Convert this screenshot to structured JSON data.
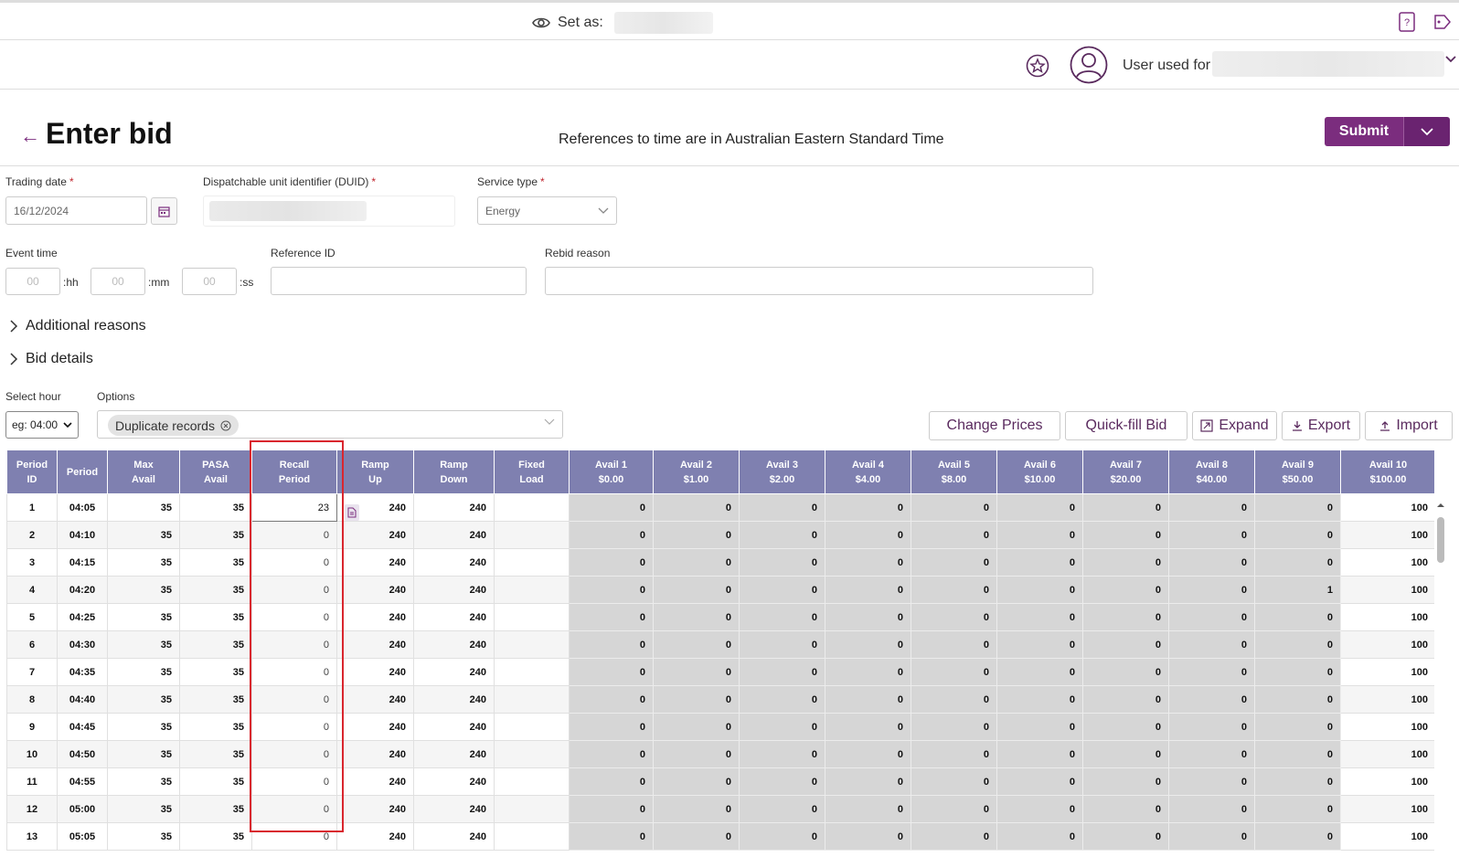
{
  "topbar": {
    "set_as_label": "Set as:"
  },
  "user": {
    "label": "User used for"
  },
  "header": {
    "title": "Enter bid",
    "timezone_note": "References to time are in Australian Eastern Standard Time",
    "submit_label": "Submit"
  },
  "form": {
    "trading_date_label": "Trading date",
    "trading_date_value": "16/12/2024",
    "duid_label": "Dispatchable unit identifier (DUID)",
    "service_type_label": "Service type",
    "service_type_value": "Energy",
    "event_time_label": "Event time",
    "hh_placeholder": "00",
    "mm_placeholder": "00",
    "ss_placeholder": "00",
    "hh_suffix": ":hh",
    "mm_suffix": ":mm",
    "ss_suffix": ":ss",
    "reference_id_label": "Reference ID",
    "rebid_reason_label": "Rebid reason",
    "required_mark": "*"
  },
  "sections": {
    "additional_reasons": "Additional reasons",
    "bid_details": "Bid details"
  },
  "controls": {
    "select_hour_label": "Select hour",
    "select_hour_value": "eg: 04:00",
    "options_label": "Options",
    "option_chip": "Duplicate records",
    "change_prices": "Change Prices",
    "quick_fill": "Quick-fill Bid",
    "expand": "Expand",
    "export": "Export",
    "import": "Import"
  },
  "grid": {
    "headers": [
      [
        "Period",
        "ID"
      ],
      [
        "Period",
        ""
      ],
      [
        "Max",
        "Avail"
      ],
      [
        "PASA",
        "Avail"
      ],
      [
        "Recall",
        "Period"
      ],
      [
        "Ramp",
        "Up"
      ],
      [
        "Ramp",
        "Down"
      ],
      [
        "Fixed",
        "Load"
      ],
      [
        "Avail 1",
        "$0.00"
      ],
      [
        "Avail 2",
        "$1.00"
      ],
      [
        "Avail 3",
        "$2.00"
      ],
      [
        "Avail 4",
        "$4.00"
      ],
      [
        "Avail 5",
        "$8.00"
      ],
      [
        "Avail 6",
        "$10.00"
      ],
      [
        "Avail 7",
        "$20.00"
      ],
      [
        "Avail 8",
        "$40.00"
      ],
      [
        "Avail 9",
        "$50.00"
      ],
      [
        "Avail 10",
        "$100.00"
      ]
    ],
    "rows": [
      [
        "1",
        "04:05",
        "35",
        "35",
        "23",
        "240",
        "240",
        "",
        "0",
        "0",
        "0",
        "0",
        "0",
        "0",
        "0",
        "0",
        "0",
        "100"
      ],
      [
        "2",
        "04:10",
        "35",
        "35",
        "0",
        "240",
        "240",
        "",
        "0",
        "0",
        "0",
        "0",
        "0",
        "0",
        "0",
        "0",
        "0",
        "100"
      ],
      [
        "3",
        "04:15",
        "35",
        "35",
        "0",
        "240",
        "240",
        "",
        "0",
        "0",
        "0",
        "0",
        "0",
        "0",
        "0",
        "0",
        "0",
        "100"
      ],
      [
        "4",
        "04:20",
        "35",
        "35",
        "0",
        "240",
        "240",
        "",
        "0",
        "0",
        "0",
        "0",
        "0",
        "0",
        "0",
        "0",
        "1",
        "100"
      ],
      [
        "5",
        "04:25",
        "35",
        "35",
        "0",
        "240",
        "240",
        "",
        "0",
        "0",
        "0",
        "0",
        "0",
        "0",
        "0",
        "0",
        "0",
        "100"
      ],
      [
        "6",
        "04:30",
        "35",
        "35",
        "0",
        "240",
        "240",
        "",
        "0",
        "0",
        "0",
        "0",
        "0",
        "0",
        "0",
        "0",
        "0",
        "100"
      ],
      [
        "7",
        "04:35",
        "35",
        "35",
        "0",
        "240",
        "240",
        "",
        "0",
        "0",
        "0",
        "0",
        "0",
        "0",
        "0",
        "0",
        "0",
        "100"
      ],
      [
        "8",
        "04:40",
        "35",
        "35",
        "0",
        "240",
        "240",
        "",
        "0",
        "0",
        "0",
        "0",
        "0",
        "0",
        "0",
        "0",
        "0",
        "100"
      ],
      [
        "9",
        "04:45",
        "35",
        "35",
        "0",
        "240",
        "240",
        "",
        "0",
        "0",
        "0",
        "0",
        "0",
        "0",
        "0",
        "0",
        "0",
        "100"
      ],
      [
        "10",
        "04:50",
        "35",
        "35",
        "0",
        "240",
        "240",
        "",
        "0",
        "0",
        "0",
        "0",
        "0",
        "0",
        "0",
        "0",
        "0",
        "100"
      ],
      [
        "11",
        "04:55",
        "35",
        "35",
        "0",
        "240",
        "240",
        "",
        "0",
        "0",
        "0",
        "0",
        "0",
        "0",
        "0",
        "0",
        "0",
        "100"
      ],
      [
        "12",
        "05:00",
        "35",
        "35",
        "0",
        "240",
        "240",
        "",
        "0",
        "0",
        "0",
        "0",
        "0",
        "0",
        "0",
        "0",
        "0",
        "100"
      ],
      [
        "13",
        "05:05",
        "35",
        "35",
        "0",
        "240",
        "240",
        "",
        "0",
        "0",
        "0",
        "0",
        "0",
        "0",
        "0",
        "0",
        "0",
        "100"
      ]
    ]
  },
  "colors": {
    "brand": "#7b2d7e",
    "grid_header": "#7f80b0",
    "highlight": "#d9262e"
  }
}
